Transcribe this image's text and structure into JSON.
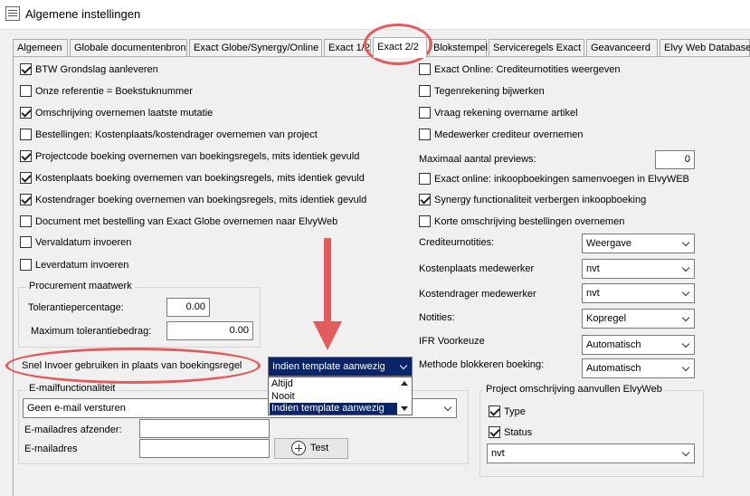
{
  "window": {
    "title": "Algemene instellingen"
  },
  "tabs": [
    "Algemeen",
    "Globale documentenbron",
    "Exact Globe/Synergy/Online",
    "Exact 1/2",
    "Exact 2/2",
    "Blokstempel",
    "Serviceregels Exact",
    "Geavanceerd",
    "Elvy Web Database"
  ],
  "active_tab": "Exact 2/2",
  "left_checks": [
    {
      "label": "BTW Grondslag aanleveren",
      "checked": true
    },
    {
      "label": "Onze referentie = Boekstuknummer",
      "checked": false
    },
    {
      "label": "Omschrijving overnemen laatste mutatie",
      "checked": true
    },
    {
      "label": "Bestellingen: Kostenplaats/kostendrager overnemen van project",
      "checked": false
    },
    {
      "label": "Projectcode boeking overnemen van boekingsregels, mits identiek gevuld",
      "checked": true
    },
    {
      "label": "Kostenplaats boeking overnemen van boekingsregels, mits identiek gevuld",
      "checked": true
    },
    {
      "label": "Kostendrager boeking overnemen van boekingsregels, mits identiek gevuld",
      "checked": true
    },
    {
      "label": "Document met bestelling van Exact Globe overnemen naar ElvyWeb",
      "checked": false
    },
    {
      "label": "Vervaldatum invoeren",
      "checked": false
    },
    {
      "label": "Leverdatum invoeren",
      "checked": false
    }
  ],
  "procurement": {
    "title": "Procurement maatwerk",
    "tolerance_pct_label": "Tolerantiepercentage:",
    "tolerance_pct_value": "0.00",
    "max_amount_label": "Maximum tolerantiebedrag:",
    "max_amount_value": "0.00"
  },
  "snel_invoer": {
    "label": "Snel Invoer gebruiken in plaats van boekingsregel",
    "selected": "Indien template aanwezig",
    "options": [
      "Altijd",
      "Nooit",
      "Indien template aanwezig"
    ]
  },
  "email": {
    "group_title": "E-mailfunctionaliteit",
    "mode_value": "Geen e-mail versturen",
    "sender_label": "E-mailadres afzender:",
    "sender_value": "",
    "address_label": "E-mailadres",
    "address_value": "",
    "test_button": "Test"
  },
  "right_checks_top": [
    {
      "label": "Exact Online: Crediteurnotities weergeven",
      "checked": false
    },
    {
      "label": "Tegenrekening bijwerken",
      "checked": false
    },
    {
      "label": "Vraag rekening overname artikel",
      "checked": false
    },
    {
      "label": "Medewerker crediteur overnemen",
      "checked": false
    }
  ],
  "max_previews": {
    "label": "Maximaal aantal previews:",
    "value": "0"
  },
  "right_checks_bottom": [
    {
      "label": "Exact online: inkoopboekingen samenvoegen in ElvyWEB",
      "checked": false
    },
    {
      "label": "Synergy functionaliteit verbergen inkoopboeking",
      "checked": true
    },
    {
      "label": "Korte omschrijving bestellingen overnemen",
      "checked": false
    }
  ],
  "right_selects": [
    {
      "label": "Crediteurnotities:",
      "value": "Weergave"
    },
    {
      "label": "Kostenplaats medewerker",
      "value": "nvt"
    },
    {
      "label": "Kostendrager medewerker",
      "value": "nvt"
    },
    {
      "label": "Notities:",
      "value": "Kopregel"
    },
    {
      "label": "IFR Voorkeuze",
      "value": "Automatisch"
    },
    {
      "label": "Methode blokkeren boeking:",
      "value": "Automatisch"
    }
  ],
  "project_group": {
    "title": "Project omschrijving aanvullen ElvyWeb",
    "type_label": "Type",
    "type_checked": true,
    "status_label": "Status",
    "status_checked": true,
    "select_value": "nvt"
  },
  "colors": {
    "highlight": "#0a246a",
    "annotation": "#e45b5b",
    "panel": "#f0f0f0"
  }
}
